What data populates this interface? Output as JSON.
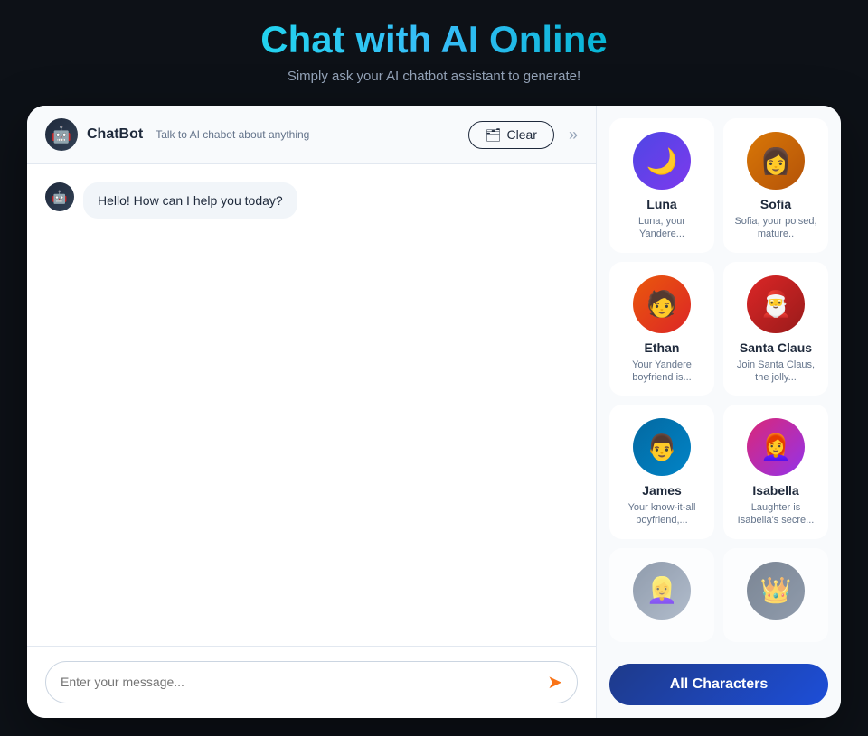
{
  "header": {
    "title": "Chat with AI Online",
    "subtitle": "Simply ask your AI chatbot assistant to generate!"
  },
  "chat": {
    "bot_name": "ChatBot",
    "bot_subtitle": "Talk to AI chabot about anything",
    "clear_label": "Clear",
    "expand_icon": "»",
    "message": {
      "text": "Hello! How can I help you today?"
    },
    "input_placeholder": "Enter your message...",
    "send_icon": "➤"
  },
  "characters": {
    "all_button_label": "All Characters",
    "items": [
      {
        "id": "luna",
        "name": "Luna",
        "desc": "Luna, your Yandere...",
        "avatar_class": "avatar-luna",
        "emoji": "🌙"
      },
      {
        "id": "sofia",
        "name": "Sofia",
        "desc": "Sofia, your poised, mature..",
        "avatar_class": "avatar-sofia",
        "emoji": "👩"
      },
      {
        "id": "ethan",
        "name": "Ethan",
        "desc": "Your Yandere boyfriend is...",
        "avatar_class": "avatar-ethan",
        "emoji": "🧑"
      },
      {
        "id": "santa",
        "name": "Santa Claus",
        "desc": "Join Santa Claus, the jolly...",
        "avatar_class": "avatar-santa",
        "emoji": "🎅"
      },
      {
        "id": "james",
        "name": "James",
        "desc": "Your know-it-all boyfriend,...",
        "avatar_class": "avatar-james",
        "emoji": "👨"
      },
      {
        "id": "isabella",
        "name": "Isabella",
        "desc": "Laughter is Isabella's secre...",
        "avatar_class": "avatar-isabella",
        "emoji": "👩‍🦰"
      },
      {
        "id": "char7",
        "name": "",
        "desc": "",
        "avatar_class": "avatar-char7",
        "emoji": "👱‍♀️",
        "partial": true
      },
      {
        "id": "char8",
        "name": "",
        "desc": "",
        "avatar_class": "avatar-char8",
        "emoji": "👑",
        "partial": true
      }
    ]
  }
}
